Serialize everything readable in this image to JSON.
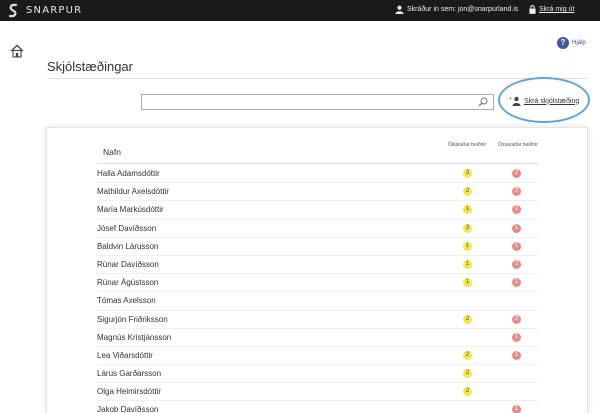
{
  "app": {
    "name": "SNARPUR"
  },
  "user": {
    "signed_in_as": "Skráður in sem: jon@snarpurland.is",
    "logout_label": "Skrá mig út"
  },
  "help": {
    "label": "Hjálp",
    "icon_glyph": "?"
  },
  "page": {
    "title": "Skjólstæðingar"
  },
  "search": {
    "value": "",
    "placeholder": ""
  },
  "actions": {
    "register_label": "Skrá skjólstæðing"
  },
  "table": {
    "name_header": "Nafn",
    "open_requests_header": "Ókláraðar beiðnir",
    "unanswered_requests_header": "Ósvaraðar beiðnir",
    "rows": [
      {
        "name": "Halla Adamsdóttir",
        "open": "3",
        "unanswered": "2"
      },
      {
        "name": "Mathildur Axelsdóttir",
        "open": "2",
        "unanswered": "2"
      },
      {
        "name": "María Markúsdóttir",
        "open": "1",
        "unanswered": "2"
      },
      {
        "name": "Jósef Davíðsson",
        "open": "3",
        "unanswered": "1"
      },
      {
        "name": "Baldvin Lárusson",
        "open": "1",
        "unanswered": "1"
      },
      {
        "name": "Rúnar Davíðsson",
        "open": "1",
        "unanswered": "2"
      },
      {
        "name": "Rúnar Ágústsson",
        "open": "1",
        "unanswered": "1"
      },
      {
        "name": "Tómas Axelsson",
        "open": "",
        "unanswered": ""
      },
      {
        "name": "Sigurjón Friðriksson",
        "open": "2",
        "unanswered": "2"
      },
      {
        "name": "Magnús Kristjánsson",
        "open": "",
        "unanswered": "1"
      },
      {
        "name": "Lea Viðarsdóttir",
        "open": "2",
        "unanswered": "1"
      },
      {
        "name": "Lárus Garðarsson",
        "open": "2",
        "unanswered": ""
      },
      {
        "name": "Olga Heimirsdóttir",
        "open": "2",
        "unanswered": ""
      },
      {
        "name": "Jakob Davíðsson",
        "open": "",
        "unanswered": "1"
      }
    ]
  },
  "colors": {
    "topbar": "#1a1a1a",
    "open_badge": "#f2e84a",
    "unanswered_badge": "#e88a8a",
    "highlight_ring": "#5fa4e0",
    "help_icon": "#3d5a9a"
  },
  "icons": {
    "brand": "snarpur-logo-icon",
    "user": "user-icon",
    "lock": "lock-icon",
    "home": "home-icon",
    "search": "search-icon",
    "add_person": "add-person-icon",
    "help": "help-icon"
  }
}
